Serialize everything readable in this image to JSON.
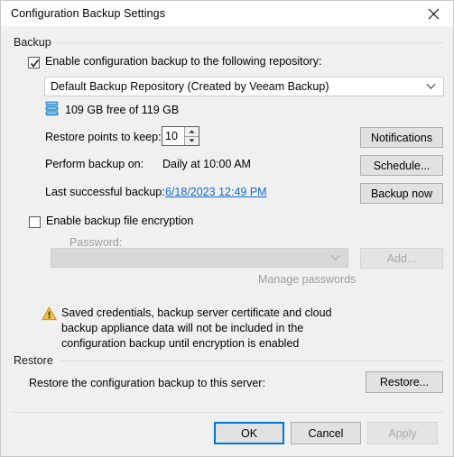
{
  "window": {
    "title": "Configuration Backup Settings",
    "close_icon": "close-icon"
  },
  "backup_group": {
    "label": "Backup",
    "enable_checkbox": {
      "label": "Enable configuration backup to the following repository:",
      "checked": true
    },
    "repository_combo": {
      "value": "Default Backup Repository (Created by Veeam Backup)",
      "options": [
        "Default Backup Repository (Created by Veeam Backup)"
      ]
    },
    "repository_capacity": {
      "icon": "repository-icon",
      "text": "109 GB free of 119 GB"
    },
    "restore_points": {
      "label": "Restore points to keep:",
      "value": "10"
    },
    "perform_backup": {
      "label": "Perform backup on:",
      "value": "Daily at 10:00 AM"
    },
    "last_backup": {
      "label": "Last successful backup:",
      "value": "6/18/2023 12:49 PM"
    },
    "notifications_button": "Notifications",
    "schedule_button": "Schedule...",
    "backup_now_button": "Backup now",
    "encryption_checkbox": {
      "label": "Enable backup file encryption",
      "checked": false
    },
    "password": {
      "label": "Password:",
      "value": "",
      "placeholder": ""
    },
    "add_button": "Add...",
    "manage_passwords_link": "Manage passwords",
    "warning": {
      "icon": "warning-icon",
      "text": "Saved credentials, backup server certificate and cloud backup appliance data will not be included in the configuration backup until encryption is enabled"
    }
  },
  "restore_group": {
    "label": "Restore",
    "description": "Restore the configuration backup to this server:",
    "restore_button": "Restore..."
  },
  "footer": {
    "ok_button": "OK",
    "cancel_button": "Cancel",
    "apply_button": "Apply"
  },
  "colors": {
    "accent": "#0078d7",
    "link": "#1168cc",
    "warning": "#f0b428",
    "repository": "#3a9bd5",
    "dialog_bg": "#f0f0f0",
    "titlebar_bg": "#ffffff"
  }
}
